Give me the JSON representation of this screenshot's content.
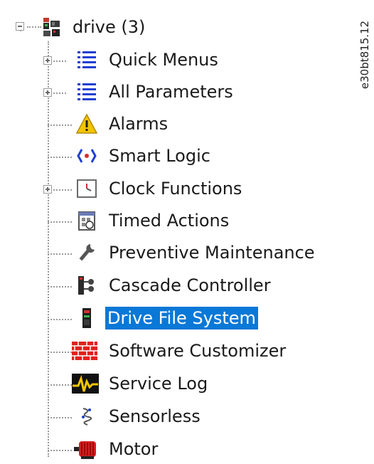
{
  "tree": {
    "root": {
      "label": "drive (3)",
      "expanded": true,
      "icon": "drive-icon"
    },
    "items": [
      {
        "label": "Quick Menus",
        "icon": "list-icon",
        "expandable": true
      },
      {
        "label": "All Parameters",
        "icon": "list-icon",
        "expandable": true
      },
      {
        "label": "Alarms",
        "icon": "warning-icon",
        "expandable": false
      },
      {
        "label": "Smart Logic",
        "icon": "logic-icon",
        "expandable": false
      },
      {
        "label": "Clock Functions",
        "icon": "clock-icon",
        "expandable": true
      },
      {
        "label": "Timed Actions",
        "icon": "calendar-icon",
        "expandable": false
      },
      {
        "label": "Preventive Maintenance",
        "icon": "wrench-icon",
        "expandable": false
      },
      {
        "label": "Cascade Controller",
        "icon": "cascade-icon",
        "expandable": false
      },
      {
        "label": "Drive File System",
        "icon": "drive-file-icon",
        "expandable": false,
        "selected": true
      },
      {
        "label": "Software Customizer",
        "icon": "brick-wall-icon",
        "expandable": false
      },
      {
        "label": "Service Log",
        "icon": "service-log-icon",
        "expandable": false
      },
      {
        "label": "Sensorless",
        "icon": "sensorless-icon",
        "expandable": false
      },
      {
        "label": "Motor",
        "icon": "motor-icon",
        "expandable": false
      }
    ]
  },
  "watermark": "e30bt815.12",
  "colors": {
    "selection": "#0a78d7",
    "list_icon": "#1f3fd1",
    "connector": "#9a9a9a"
  }
}
